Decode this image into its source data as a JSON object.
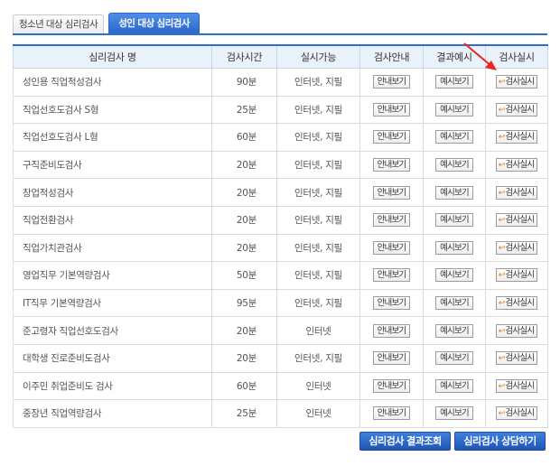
{
  "tabs": [
    {
      "label": "청소년 대상 심리검사",
      "active": false
    },
    {
      "label": "성인 대상 심리검사",
      "active": true
    }
  ],
  "table": {
    "headers": [
      "심리검사 명",
      "검사시간",
      "실시가능",
      "검사안내",
      "결과예시",
      "검사실시"
    ],
    "guide_button_label": "안내보기",
    "sample_button_label": "예시보기",
    "run_button_label": "검사실시",
    "rows": [
      {
        "name": "성인용 직업적성검사",
        "time": "90분",
        "method": "인터넷, 지필"
      },
      {
        "name": "직업선호도검사 S형",
        "time": "25분",
        "method": "인터넷, 지필"
      },
      {
        "name": "직업선호도검사 L형",
        "time": "60분",
        "method": "인터넷, 지필"
      },
      {
        "name": "구직준비도검사",
        "time": "20분",
        "method": "인터넷, 지필"
      },
      {
        "name": "창업적성검사",
        "time": "20분",
        "method": "인터넷, 지필"
      },
      {
        "name": "직업전환검사",
        "time": "20분",
        "method": "인터넷, 지필"
      },
      {
        "name": "직업가치관검사",
        "time": "20분",
        "method": "인터넷, 지필"
      },
      {
        "name": "영업직무 기본역량검사",
        "time": "50분",
        "method": "인터넷, 지필"
      },
      {
        "name": "IT직무 기본역량검사",
        "time": "95분",
        "method": "인터넷, 지필"
      },
      {
        "name": "준고령자 직업선호도검사",
        "time": "20분",
        "method": "인터넷"
      },
      {
        "name": "대학생 진로준비도검사",
        "time": "20분",
        "method": "인터넷, 지필"
      },
      {
        "name": "이주민 취업준비도 검사",
        "time": "60분",
        "method": "인터넷"
      },
      {
        "name": "중장년 직업역량검사",
        "time": "25분",
        "method": "인터넷"
      }
    ]
  },
  "bottom_buttons": {
    "results": "심리검사 결과조회",
    "counsel": "심리검사 상담하기"
  },
  "colors": {
    "accent": "#2f6fcf",
    "header_bg": "#e9f1fb",
    "pointer_arrow": "#e8271f",
    "run_icon": "#e07a12"
  },
  "icons": {
    "run_button": "return-arrow-icon",
    "pointer": "red-pointer-arrow-icon"
  }
}
